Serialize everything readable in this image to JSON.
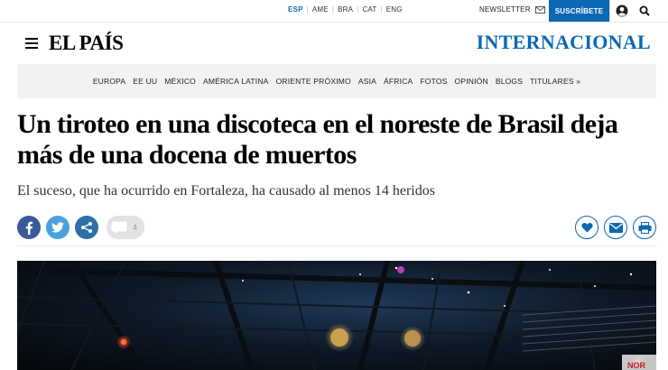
{
  "topbar": {
    "editions": [
      "ESP",
      "AME",
      "BRA",
      "CAT",
      "ENG"
    ],
    "active_edition": "ESP",
    "newsletter_label": "NEWSLETTER",
    "subscribe_label": "SUSCRÍBETE"
  },
  "header": {
    "logo": "EL PAÍS",
    "section": "INTERNACIONAL"
  },
  "nav": {
    "items": [
      "EUROPA",
      "EE UU",
      "MÉXICO",
      "AMÉRICA LATINA",
      "ORIENTE PRÓXIMO",
      "ASIA",
      "ÁFRICA",
      "FOTOS",
      "OPINIÓN",
      "BLOGS",
      "TITULARES »"
    ]
  },
  "article": {
    "headline": "Un tiroteo en una discoteca en el noreste de Brasil deja más de una docena de muertos",
    "subheadline": "El suceso, que ha ocurrido en Fortaleza, ha causado al menos 14 heridos",
    "comment_count": "4"
  },
  "colors": {
    "brand_blue": "#0c68b3",
    "facebook": "#3b5a9a",
    "twitter": "#4aa0e0",
    "nav_bg": "#f2f2f2"
  },
  "icons": {
    "menu": "hamburger-icon",
    "mail": "mail-icon",
    "user": "user-icon",
    "search": "search-icon",
    "facebook": "facebook-icon",
    "twitter": "twitter-icon",
    "share": "share-icon",
    "comments": "comment-icon",
    "save": "heart-icon",
    "email": "envelope-icon",
    "print": "print-icon"
  }
}
